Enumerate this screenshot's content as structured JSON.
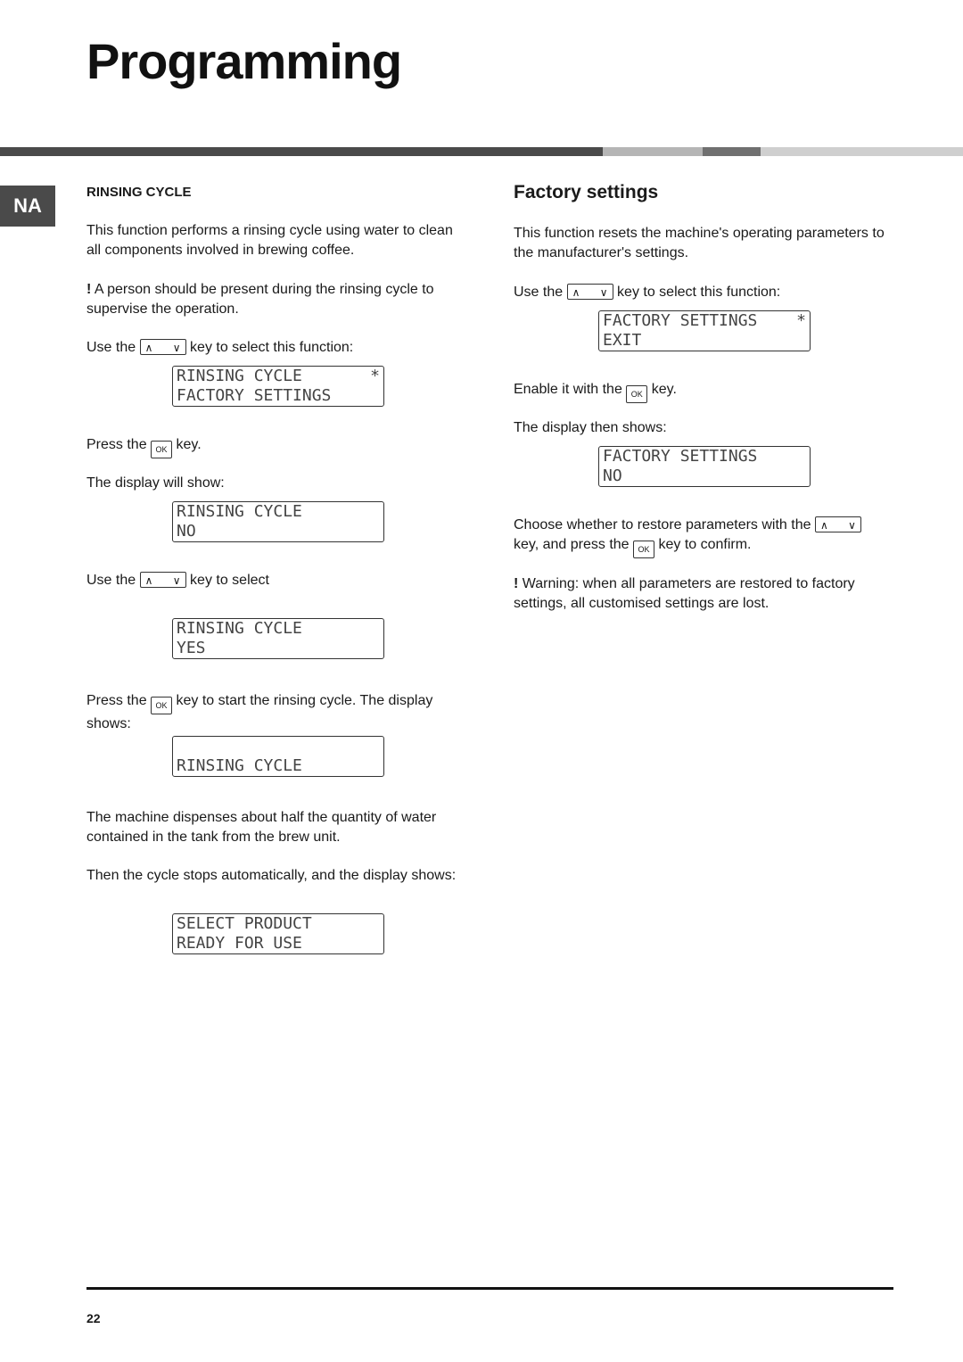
{
  "page": {
    "title": "Programming",
    "language_tab": "NA",
    "page_number": "22",
    "band_colors": [
      "#4a4a4a",
      "#b5b5b5",
      "#707070",
      "#cfcfcf"
    ]
  },
  "keys": {
    "up": "∧",
    "down": "∨",
    "ok": "OK"
  },
  "rinsing": {
    "heading": "RINSING CYCLE",
    "intro": "This function performs a rinsing cycle using water to clean all components involved in brewing coffee.",
    "warning_mark": "!",
    "warning": " A person should be present during the rinsing cycle to supervise the operation.",
    "use_the_1": "Use the",
    "select_fn": "key to select this function:",
    "lcd1": {
      "line1": "RINSING CYCLE",
      "star": "*",
      "line2": "FACTORY SETTINGS"
    },
    "press_the": "Press the",
    "key_dot": "key.",
    "display_will_show": "The display will show:",
    "lcd2": {
      "line1": "RINSING CYCLE",
      "line2": "NO"
    },
    "use_the_2": "Use the",
    "key_to_select": "key to select",
    "lcd3": {
      "line1": "RINSING CYCLE",
      "line2": "YES"
    },
    "press_the_2": "Press the",
    "start_text": "key to start the rinsing cycle. The display",
    "shows": "shows:",
    "lcd4": {
      "line1": "",
      "line2": "RINSING CYCLE"
    },
    "dispense": "The machine dispenses about half the quantity of water contained in the tank from the brew unit.",
    "stops": "Then the cycle stops automatically, and the display shows:",
    "lcd5": {
      "line1": "SELECT PRODUCT",
      "line2": "READY FOR USE"
    }
  },
  "factory": {
    "heading": "Factory settings",
    "intro": "This function resets the machine's operating parameters to the manufacturer's settings.",
    "use_the": "Use the",
    "select_fn": "key to select this function:",
    "lcd1": {
      "line1": "FACTORY SETTINGS",
      "star": "*",
      "line2": "EXIT"
    },
    "enable": "Enable it with the",
    "key_dot": "key.",
    "display_then": "The display then shows:",
    "lcd2": {
      "line1": "FACTORY SETTINGS",
      "line2": "NO"
    },
    "choose": "Choose whether to restore parameters with the",
    "key_and_press": "key, and press the",
    "confirm": "key to confirm.",
    "warning_mark": "!",
    "warning": " Warning: when all parameters are restored to factory settings, all customised settings are lost."
  }
}
